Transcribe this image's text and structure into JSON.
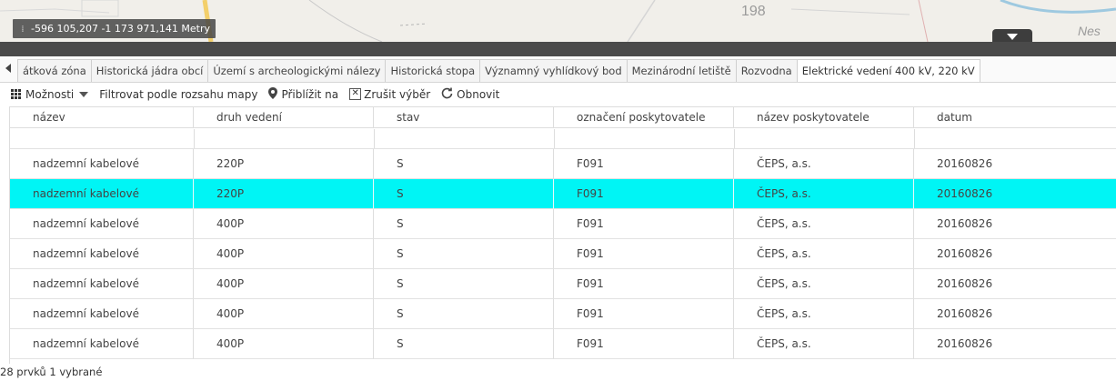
{
  "map": {
    "coordinates": "-596 105,207 -1 173 971,141 Metry",
    "label_number": "198",
    "label_place": "Nes"
  },
  "tabs": [
    {
      "label": "átková zóna",
      "active": false
    },
    {
      "label": "Historická jádra obcí",
      "active": false
    },
    {
      "label": "Území s archeologickými nálezy",
      "active": false
    },
    {
      "label": "Historická stopa",
      "active": false
    },
    {
      "label": "Významný vyhlídkový bod",
      "active": false
    },
    {
      "label": "Mezinárodní letiště",
      "active": false
    },
    {
      "label": "Rozvodna",
      "active": false
    },
    {
      "label": "Elektrické vedení 400 kV, 220 kV",
      "active": true
    }
  ],
  "toolbar": {
    "options": "Možnosti",
    "filter": "Filtrovat podle rozsahu mapy",
    "zoom": "Přiblížit na",
    "clear": "Zrušit výběr",
    "refresh": "Obnovit"
  },
  "table": {
    "columns": [
      "název",
      "druh vedení",
      "stav",
      "označení poskytovatele",
      "název poskytovatele",
      "datum"
    ],
    "rows": [
      {
        "cells": [
          "nadzemní kabelové",
          "220P",
          "S",
          "F091",
          "ČEPS, a.s.",
          "20160826"
        ],
        "selected": false
      },
      {
        "cells": [
          "nadzemní kabelové",
          "220P",
          "S",
          "F091",
          "ČEPS, a.s.",
          "20160826"
        ],
        "selected": true
      },
      {
        "cells": [
          "nadzemní kabelové",
          "400P",
          "S",
          "F091",
          "ČEPS, a.s.",
          "20160826"
        ],
        "selected": false
      },
      {
        "cells": [
          "nadzemní kabelové",
          "400P",
          "S",
          "F091",
          "ČEPS, a.s.",
          "20160826"
        ],
        "selected": false
      },
      {
        "cells": [
          "nadzemní kabelové",
          "400P",
          "S",
          "F091",
          "ČEPS, a.s.",
          "20160826"
        ],
        "selected": false
      },
      {
        "cells": [
          "nadzemní kabelové",
          "400P",
          "S",
          "F091",
          "ČEPS, a.s.",
          "20160826"
        ],
        "selected": false
      },
      {
        "cells": [
          "nadzemní kabelové",
          "400P",
          "S",
          "F091",
          "ČEPS, a.s.",
          "20160826"
        ],
        "selected": false
      }
    ],
    "selection_color": "#00f5f5"
  },
  "status": "28 prvků  1 vybrané"
}
